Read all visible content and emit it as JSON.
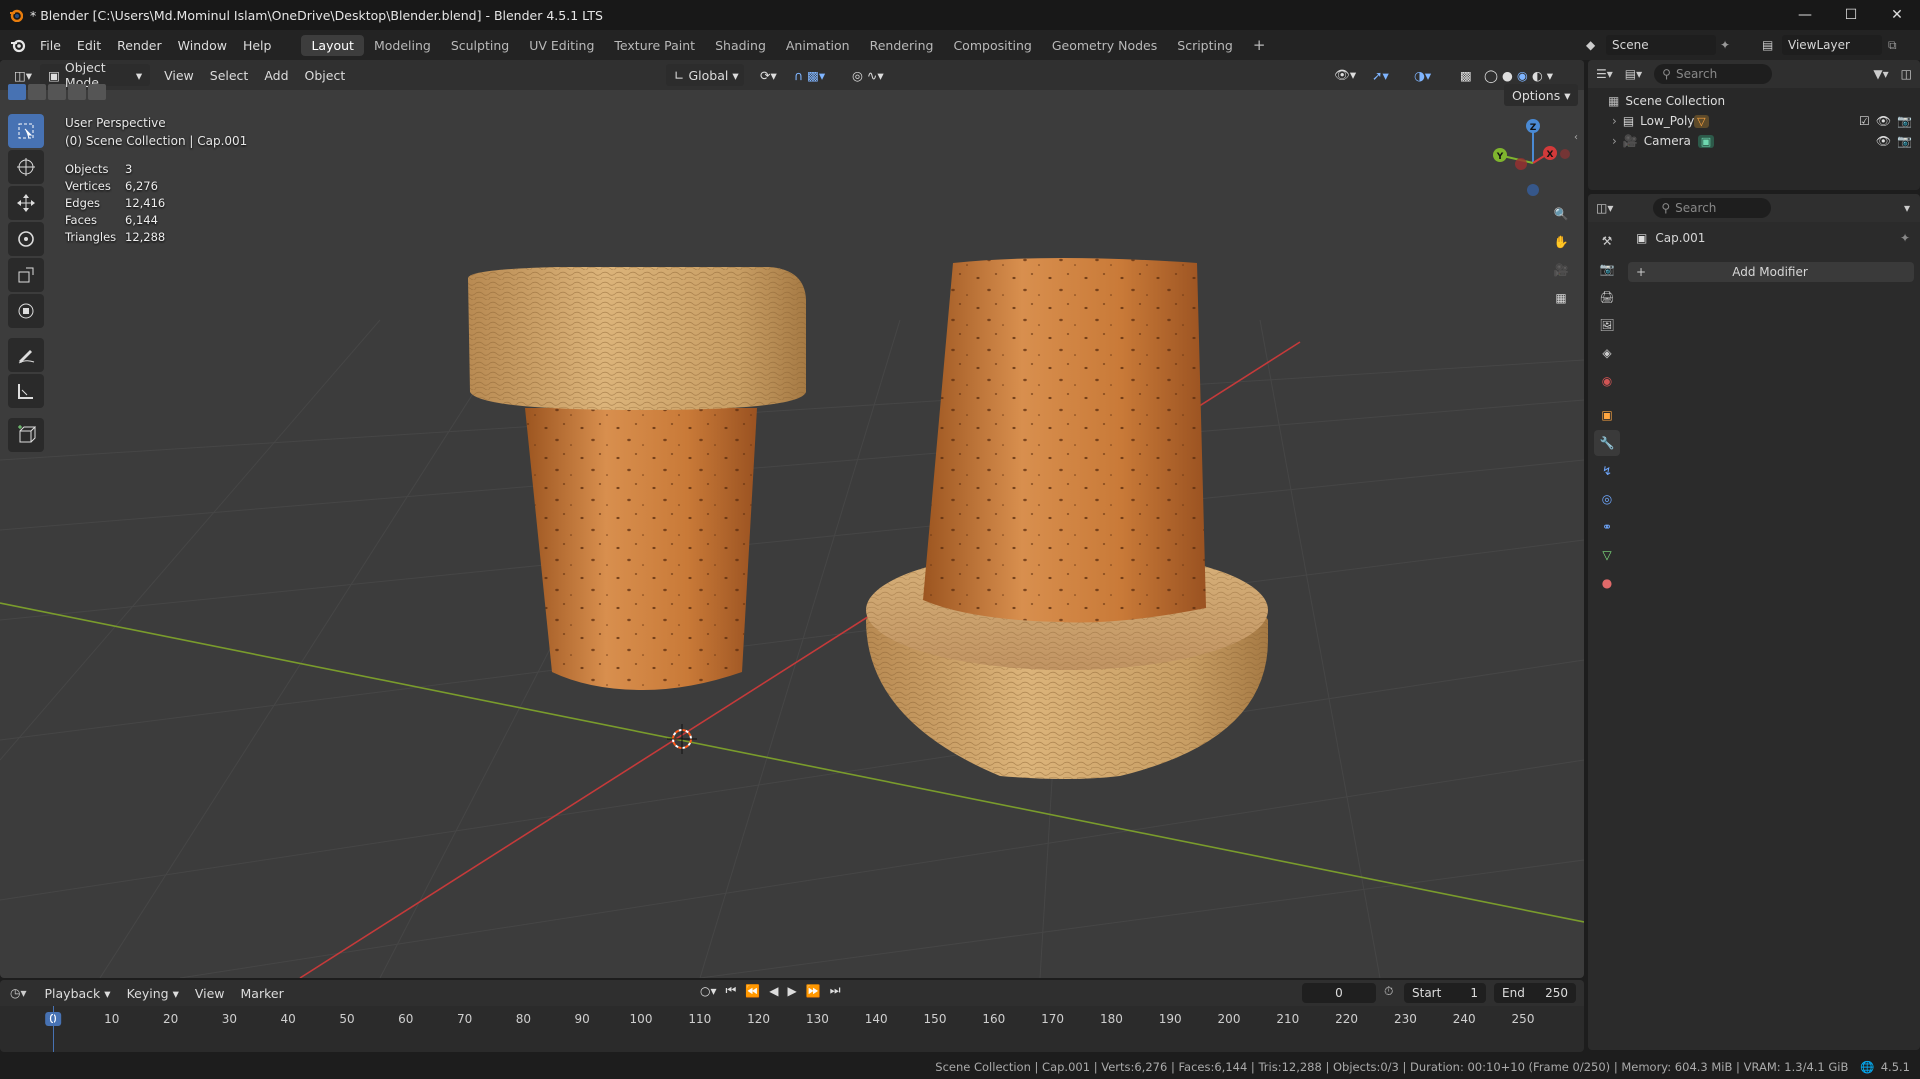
{
  "window": {
    "title": "* Blender [C:\\Users\\Md.Mominul Islam\\OneDrive\\Desktop\\Blender.blend] - Blender 4.5.1 LTS",
    "controls": [
      "minimize",
      "maximize",
      "close"
    ]
  },
  "menubar": {
    "menus": [
      "File",
      "Edit",
      "Render",
      "Window",
      "Help"
    ],
    "workspaces": [
      "Layout",
      "Modeling",
      "Sculpting",
      "UV Editing",
      "Texture Paint",
      "Shading",
      "Animation",
      "Rendering",
      "Compositing",
      "Geometry Nodes",
      "Scripting"
    ],
    "active_workspace": "Layout",
    "add_tab": "+",
    "scene_label": "Scene",
    "viewlayer_label": "ViewLayer"
  },
  "viewport": {
    "mode": "Object Mode",
    "menus": [
      "View",
      "Select",
      "Add",
      "Object"
    ],
    "transform_orientation": "Global",
    "options_label": "Options",
    "perspective_label": "User Perspective",
    "collection_label": "(0) Scene Collection | Cap.001",
    "stats": [
      {
        "key": "Objects",
        "value": "3"
      },
      {
        "key": "Vertices",
        "value": "6,276"
      },
      {
        "key": "Edges",
        "value": "12,416"
      },
      {
        "key": "Faces",
        "value": "6,144"
      },
      {
        "key": "Triangles",
        "value": "12,288"
      }
    ],
    "gizmo_axes": [
      "Z",
      "Y",
      "X"
    ],
    "tools": [
      "select-box",
      "cursor",
      "move",
      "rotate",
      "scale",
      "transform",
      "annotate",
      "measure",
      "add-cube"
    ],
    "colors": {
      "bg": "#3c3c3c",
      "x_axis": "#c53a3a",
      "y_axis": "#7a9c2c",
      "cork": "#c67b3a",
      "wood": "#c9a36a"
    }
  },
  "outliner": {
    "search_placeholder": "Search",
    "root": "Scene Collection",
    "items": [
      {
        "name": "Low_Poly",
        "type": "collection"
      },
      {
        "name": "Camera",
        "type": "camera"
      }
    ]
  },
  "properties": {
    "search_placeholder": "Search",
    "object_name": "Cap.001",
    "add_modifier_label": "Add Modifier",
    "tabs": [
      "tool",
      "render",
      "output",
      "view-layer",
      "scene",
      "world",
      "object",
      "modifiers",
      "particles",
      "physics",
      "constraints",
      "data",
      "material"
    ]
  },
  "timeline": {
    "menus": [
      "Playback",
      "Keying",
      "View",
      "Marker"
    ],
    "current_frame": "0",
    "start_label": "Start",
    "start_value": "1",
    "end_label": "End",
    "end_value": "250",
    "ruler_ticks": [
      "0",
      "10",
      "20",
      "30",
      "40",
      "50",
      "60",
      "70",
      "80",
      "90",
      "100",
      "110",
      "120",
      "130",
      "140",
      "150",
      "160",
      "170",
      "180",
      "190",
      "200",
      "210",
      "220",
      "230",
      "240",
      "250"
    ]
  },
  "statusbar": {
    "text": "Scene Collection | Cap.001 | Verts:6,276 | Faces:6,144 | Tris:12,288 | Objects:0/3 | Duration: 00:10+10 (Frame 0/250) | Memory: 604.3 MiB | VRAM: 1.3/4.1 GiB",
    "version": "4.5.1"
  }
}
